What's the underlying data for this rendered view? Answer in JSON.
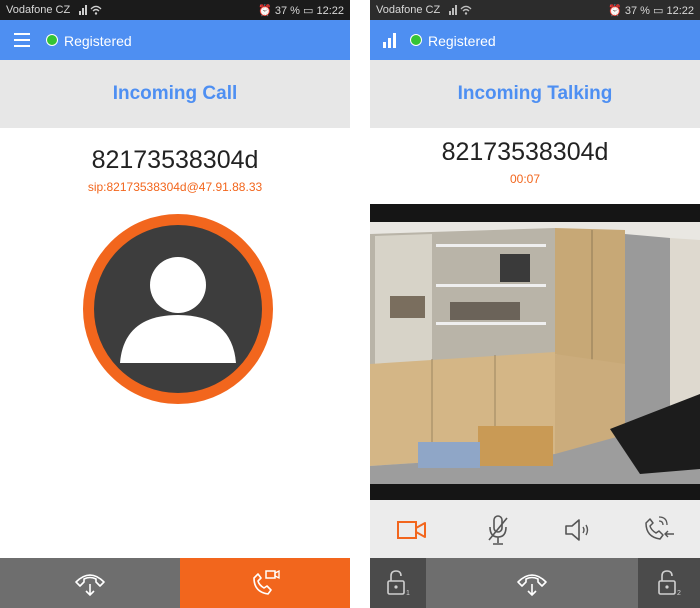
{
  "left_screen": {
    "status_bar": {
      "carrier": "Vodafone CZ",
      "battery": "37 %",
      "time": "12:22"
    },
    "app_bar": {
      "registration_status": "Registered"
    },
    "title": "Incoming Call",
    "caller": {
      "number": "82173538304d",
      "sip_uri": "sip:82173538304d@47.91.88.33"
    },
    "actions": {
      "decline": "hangup-icon",
      "answer_video": "video-call-icon"
    }
  },
  "right_screen": {
    "status_bar": {
      "carrier": "Vodafone CZ",
      "battery": "37 %",
      "time": "12:22"
    },
    "app_bar": {
      "registration_status": "Registered"
    },
    "title": "Incoming Talking",
    "caller": {
      "number": "82173538304d",
      "duration": "00:07"
    },
    "controls": [
      "video-camera-icon",
      "mute-microphone-icon",
      "speaker-icon",
      "call-transfer-icon"
    ],
    "bottom_actions": [
      "unlock-1-icon",
      "hangup-icon",
      "unlock-2-icon"
    ]
  },
  "colors": {
    "accent": "#f2661d",
    "primary": "#4e8ff2",
    "registered": "#35c435",
    "dark_button": "#6e6e6e"
  }
}
